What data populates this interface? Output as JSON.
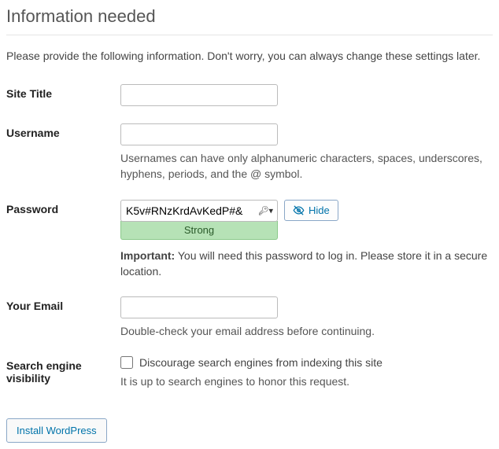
{
  "heading": "Information needed",
  "intro": "Please provide the following information. Don't worry, you can always change these settings later.",
  "fields": {
    "site_title": {
      "label": "Site Title",
      "value": ""
    },
    "username": {
      "label": "Username",
      "value": "",
      "help": "Usernames can have only alphanumeric characters, spaces, underscores, hyphens, periods, and the @ symbol."
    },
    "password": {
      "label": "Password",
      "value": "K5v#RNzKrdAvKedP#&",
      "hide_label": "Hide",
      "strength": "Strong",
      "important_label": "Important:",
      "important_text": "You will need this password to log in. Please store it in a secure location."
    },
    "email": {
      "label": "Your Email",
      "value": "",
      "help": "Double-check your email address before continuing."
    },
    "sev": {
      "label": "Search engine visibility",
      "checkbox_label": "Discourage search engines from indexing this site",
      "help": "It is up to search engines to honor this request.",
      "checked": false
    }
  },
  "submit": {
    "label": "Install WordPress"
  }
}
